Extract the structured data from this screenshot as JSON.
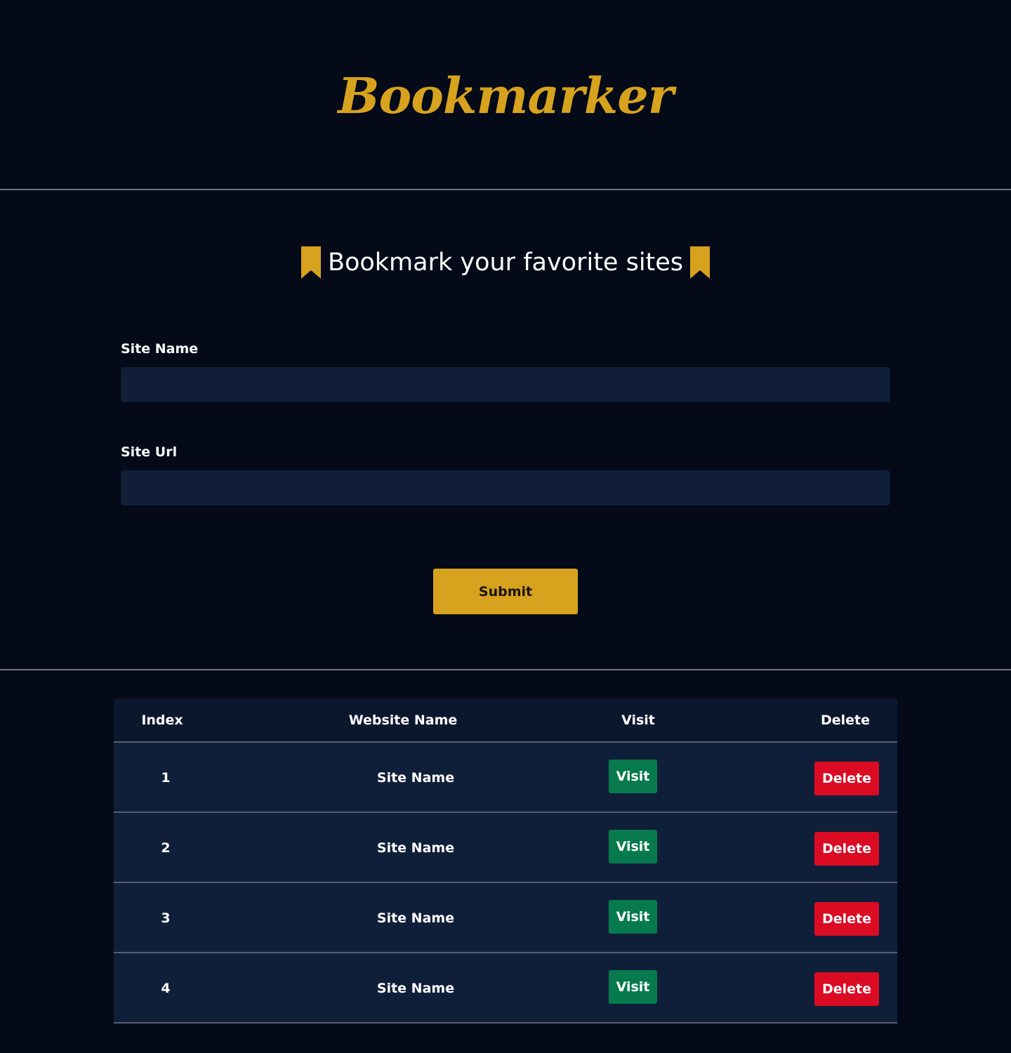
{
  "brand": {
    "logo_text": "Bookmarker"
  },
  "colors": {
    "background": "#040a18",
    "accent": "#d7a21e",
    "input_bg": "#101e37",
    "table_head_bg": "#0b172c",
    "row_bg": "#101f39",
    "visit": "#077a4d",
    "delete": "#db0b24"
  },
  "headline": {
    "text": "Bookmark your favorite sites",
    "icon": "bookmark-icon"
  },
  "form": {
    "site_name_label": "Site Name",
    "site_name_value": "",
    "site_url_label": "Site Url",
    "site_url_value": "",
    "submit_label": "Submit"
  },
  "table": {
    "headers": {
      "index": "Index",
      "name": "Website Name",
      "visit": "Visit",
      "delete": "Delete"
    },
    "rows": [
      {
        "index": "1",
        "name": "Site Name",
        "visit_label": "Visit",
        "delete_label": "Delete"
      },
      {
        "index": "2",
        "name": "Site Name",
        "visit_label": "Visit",
        "delete_label": "Delete"
      },
      {
        "index": "3",
        "name": "Site Name",
        "visit_label": "Visit",
        "delete_label": "Delete"
      },
      {
        "index": "4",
        "name": "Site Name",
        "visit_label": "Visit",
        "delete_label": "Delete"
      }
    ]
  }
}
